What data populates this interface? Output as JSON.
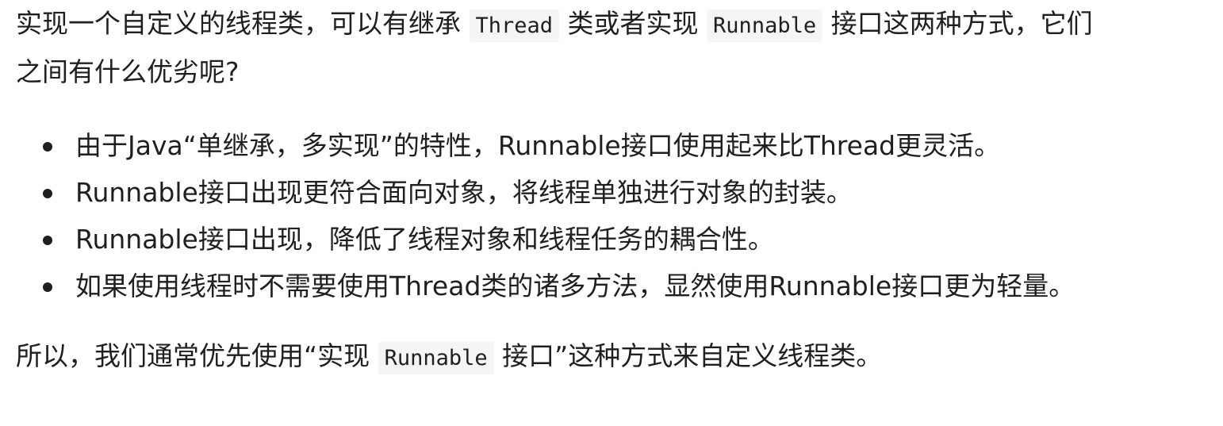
{
  "intro": {
    "part1": "实现一个自定义的线程类，可以有继承",
    "code1": "Thread",
    "part2": "类或者实现",
    "code2": "Runnable",
    "part3": "接口这两种方式，它们之间有什么优劣呢?"
  },
  "bullets": [
    "由于Java“单继承，多实现”的特性，Runnable接口使用起来比Thread更灵活。",
    "Runnable接口出现更符合面向对象，将线程单独进行对象的封装。",
    "Runnable接口出现，降低了线程对象和线程任务的耦合性。",
    "如果使用线程时不需要使用Thread类的诸多方法，显然使用Runnable接口更为轻量。"
  ],
  "outro": {
    "part1": "所以，我们通常优先使用“实现",
    "code1": "Runnable",
    "part2": "接口”这种方式来自定义线程类。"
  }
}
